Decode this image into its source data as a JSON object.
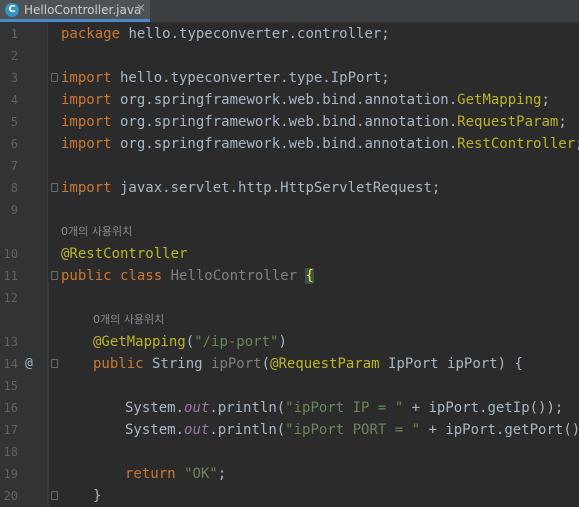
{
  "tab": {
    "title": "HelloController.java",
    "icon": "C",
    "close": "✕"
  },
  "lines": [
    {
      "n": "1"
    },
    {
      "n": "2"
    },
    {
      "n": "3"
    },
    {
      "n": "4"
    },
    {
      "n": "5"
    },
    {
      "n": "6"
    },
    {
      "n": "7"
    },
    {
      "n": "8"
    },
    {
      "n": "9"
    },
    {
      "n": "10"
    },
    {
      "n": "11"
    },
    {
      "n": "12"
    },
    {
      "n": "13"
    },
    {
      "n": "14"
    },
    {
      "n": "15"
    },
    {
      "n": "16"
    },
    {
      "n": "17"
    },
    {
      "n": "18"
    },
    {
      "n": "19"
    },
    {
      "n": "20"
    }
  ],
  "code": {
    "l1": {
      "kw": "package",
      "rest": " hello.typeconverter.controller;"
    },
    "l3": {
      "kw": "import",
      "rest": " hello.typeconverter.type.IpPort;"
    },
    "l4": {
      "kw": "import",
      "pkg": " org.springframework.web.bind.annotation.",
      "cls": "GetMapping",
      "end": ";"
    },
    "l5": {
      "kw": "import",
      "pkg": " org.springframework.web.bind.annotation.",
      "cls": "RequestParam",
      "end": ";"
    },
    "l6": {
      "kw": "import",
      "pkg": " org.springframework.web.bind.annotation.",
      "cls": "RestController",
      "end": ";"
    },
    "l8": {
      "kw": "import",
      "rest": " javax.servlet.http.HttpServletRequest;"
    },
    "usage_hint_1": "0개의 사용위치",
    "l10": {
      "ann": "@RestController"
    },
    "l11": {
      "kw1": "public",
      "kw2": " class",
      "name": " HelloController ",
      "brace": "{"
    },
    "usage_hint_2": "0개의 사용위치",
    "l13": {
      "ann": "@GetMapping",
      "p1": "(",
      "str": "\"/ip-port\"",
      "p2": ")"
    },
    "l14": {
      "kw": "public",
      "t1": " String ",
      "m": "ipPort",
      "p1": "(",
      "ann": "@RequestParam",
      "t2": " IpPort ipPort) {"
    },
    "l14_marker": "@",
    "l16": {
      "a": "System.",
      "f": "out",
      "b": ".println(",
      "s": "\"ipPort IP = \"",
      "c": " + ipPort.getIp());"
    },
    "l17": {
      "a": "System.",
      "f": "out",
      "b": ".println(",
      "s": "\"ipPort PORT = \"",
      "c": " + ipPort.getPort());"
    },
    "l19": {
      "kw": "return",
      "sp": " ",
      "str": "\"OK\"",
      "end": ";"
    },
    "l20": {
      "brace": "}"
    }
  }
}
